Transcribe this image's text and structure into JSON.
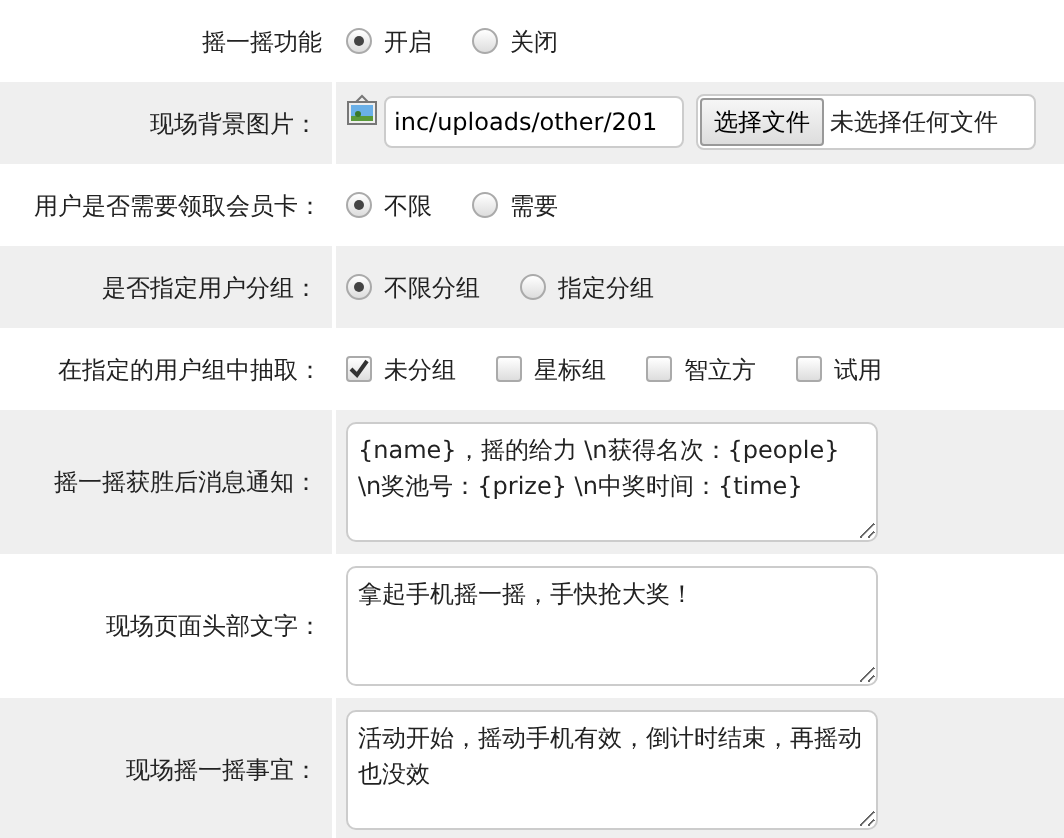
{
  "rows": [
    {
      "label": "摇一摇功能",
      "kind": "radio",
      "options": [
        {
          "label": "开启",
          "selected": true
        },
        {
          "label": "关闭",
          "selected": false
        }
      ]
    },
    {
      "label": "现场背景图片：",
      "kind": "file",
      "path": "inc/uploads/other/201",
      "button": "选择文件",
      "status": "未选择任何文件"
    },
    {
      "label": "用户是否需要领取会员卡：",
      "kind": "radio",
      "options": [
        {
          "label": "不限",
          "selected": true
        },
        {
          "label": "需要",
          "selected": false
        }
      ]
    },
    {
      "label": "是否指定用户分组：",
      "kind": "radio",
      "options": [
        {
          "label": "不限分组",
          "selected": true
        },
        {
          "label": "指定分组",
          "selected": false
        }
      ]
    },
    {
      "label": "在指定的用户组中抽取：",
      "kind": "checkbox",
      "options": [
        {
          "label": "未分组",
          "checked": true
        },
        {
          "label": "星标组",
          "checked": false
        },
        {
          "label": "智立方",
          "checked": false
        },
        {
          "label": "试用",
          "checked": false
        }
      ]
    },
    {
      "label": "摇一摇获胜后消息通知：",
      "kind": "textarea",
      "value": "{name}，摇的给力 \\n获得名次：{people} \\n奖池号：{prize} \\n中奖时间：{time}"
    },
    {
      "label": "现场页面头部文字：",
      "kind": "textarea",
      "value": "拿起手机摇一摇，手快抢大奖！"
    },
    {
      "label": "现场摇一摇事宜：",
      "kind": "textarea",
      "value": "活动开始，摇动手机有效，倒计时结束，再摇动也没效"
    }
  ]
}
